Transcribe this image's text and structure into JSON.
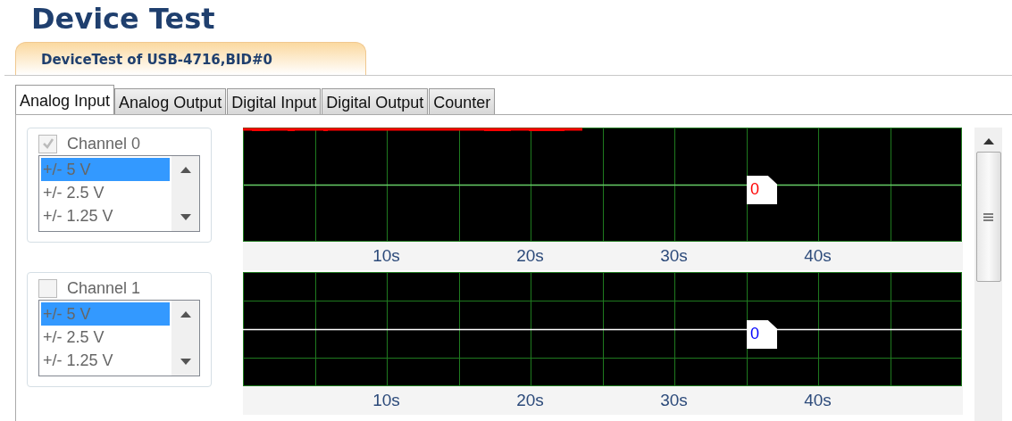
{
  "title": "Device Test",
  "device_tab": {
    "label": "DeviceTest of USB-4716,BID#0",
    "selected": true
  },
  "tabs": [
    {
      "label": "Analog Input",
      "selected": true
    },
    {
      "label": "Analog Output",
      "selected": false
    },
    {
      "label": "Digital Input",
      "selected": false
    },
    {
      "label": "Digital Output",
      "selected": false
    },
    {
      "label": "Counter",
      "selected": false
    }
  ],
  "channels": [
    {
      "name": "Channel 0",
      "checked": true,
      "ranges": [
        {
          "label": "+/- 5 V",
          "selected": true
        },
        {
          "label": "+/- 2.5 V",
          "selected": false
        },
        {
          "label": "+/- 1.25 V",
          "selected": false
        }
      ],
      "chart": {
        "trace": {
          "kind": "clipped",
          "color": "#ff0000"
        },
        "marker": {
          "label": "0",
          "color": "#ff0000"
        },
        "time_labels": [
          "10s",
          "20s",
          "30s",
          "40s"
        ]
      }
    },
    {
      "name": "Channel 1",
      "checked": false,
      "ranges": [
        {
          "label": "+/- 5 V",
          "selected": true
        },
        {
          "label": "+/- 2.5 V",
          "selected": false
        },
        {
          "label": "+/- 1.25 V",
          "selected": false
        }
      ],
      "chart": {
        "trace": {
          "kind": "flat",
          "color": "#ffffff"
        },
        "marker": {
          "label": "0",
          "color": "#0000ff"
        },
        "time_labels": [
          "10s",
          "20s",
          "30s",
          "40s"
        ]
      }
    }
  ]
}
